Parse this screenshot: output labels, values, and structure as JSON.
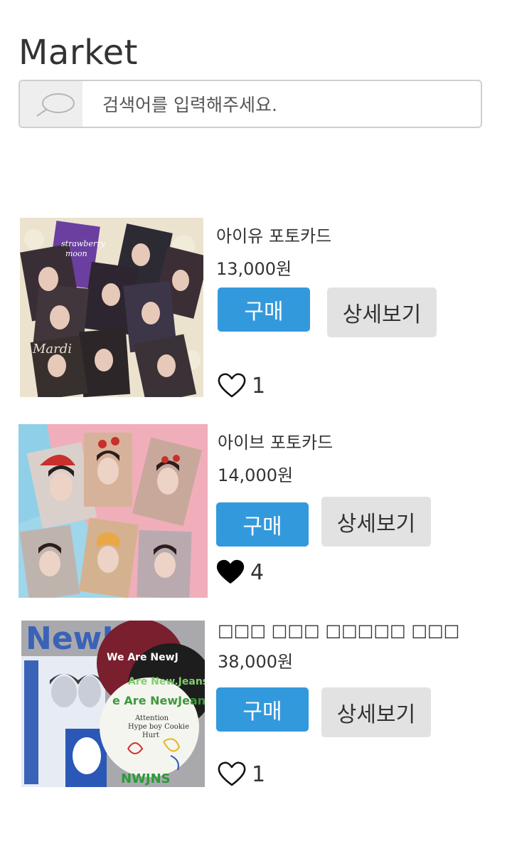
{
  "page": {
    "title": "Market"
  },
  "search": {
    "placeholder": "검색어를 입력해주세요."
  },
  "products": [
    {
      "name": "아이유 포토카드",
      "price": "13,000원",
      "buy_label": "구매",
      "detail_label": "상세보기",
      "likes": "1",
      "liked": false
    },
    {
      "name": "아이브 포토카드",
      "price": "14,000원",
      "buy_label": "구매",
      "detail_label": "상세보기",
      "likes": "4",
      "liked": true
    },
    {
      "name": "□□□ □□□ □□□□□ □□□",
      "price": "38,000원",
      "buy_label": "구매",
      "detail_label": "상세보기",
      "likes": "1",
      "liked": false
    }
  ],
  "colors": {
    "accent": "#3399dd",
    "detail_bg": "#e2e2e2",
    "text": "#333333"
  },
  "icons": {
    "search": "search-icon",
    "like": "heart-icon"
  }
}
